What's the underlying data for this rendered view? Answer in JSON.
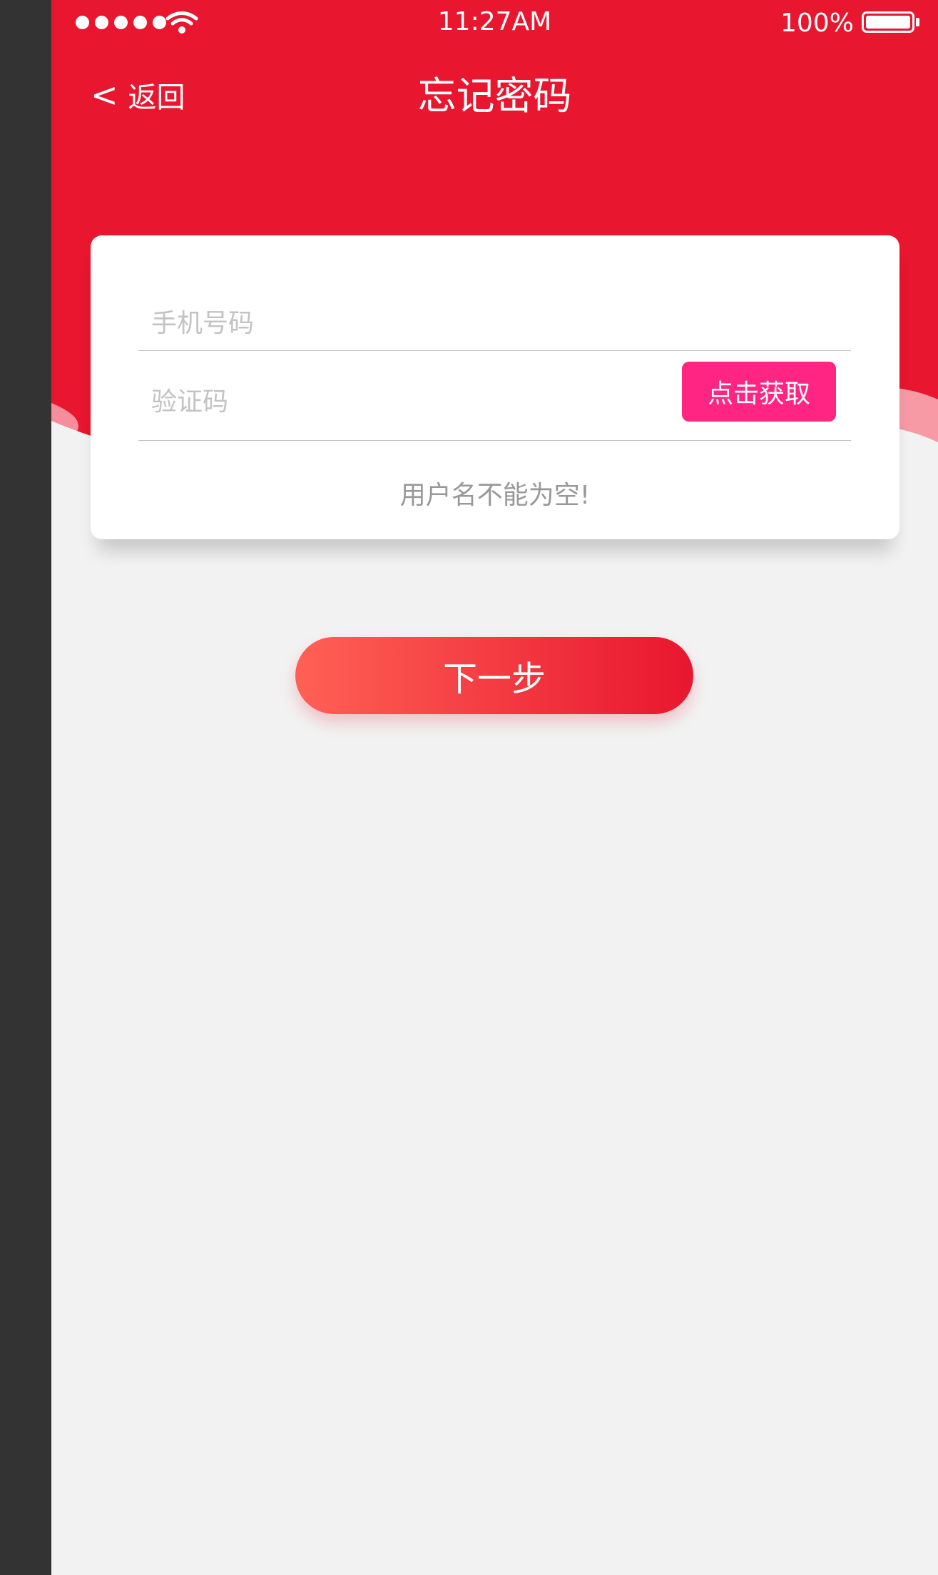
{
  "colors": {
    "header_bg": "#e8162f",
    "code_button_bg": "#ff2583",
    "placeholder": "#c3c3c3",
    "error_text": "#989898",
    "next_gradient_start": "#ff6155",
    "next_gradient_end": "#e8162f"
  },
  "status_bar": {
    "time": "11:27AM",
    "battery": "100%",
    "icons": [
      "signal-dots-icon",
      "wifi-icon",
      "battery-icon"
    ]
  },
  "nav": {
    "back_icon": "chevron-left-icon",
    "back_label": "返回",
    "title": "忘记密码"
  },
  "form": {
    "phone_placeholder": "手机号码",
    "code_placeholder": "验证码",
    "get_code_label": "点击获取",
    "error_message": "用户名不能为空!"
  },
  "next_button_label": "下一步"
}
